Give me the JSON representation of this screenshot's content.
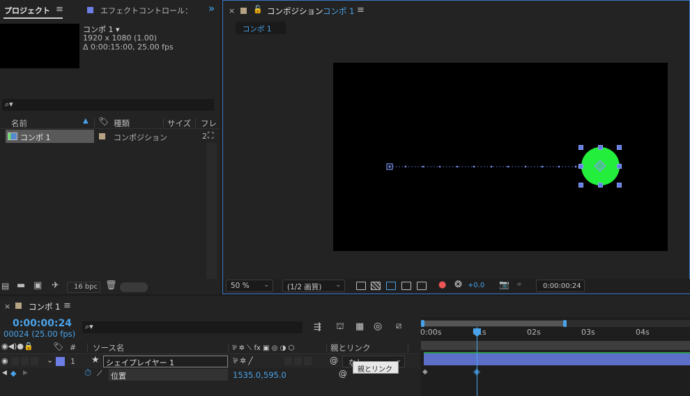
{
  "project_panel": {
    "tab_project": "プロジェクト",
    "tab_menu": "≡",
    "tab_effect": "エフェクトコントロール：",
    "more": "»",
    "comp_name": "コンポ 1 ▾",
    "comp_res": "1920 x 1080 (1.00)",
    "comp_dur": "Δ 0:00:15:00, 25.00 fps",
    "search_icon_text": "⌕▾",
    "col_name": "名前",
    "col_type": "種類",
    "col_size": "サイズ",
    "col_frame": "フレ",
    "item_name": "コンポ 1",
    "item_type": "コンポジション",
    "item_num": "2",
    "bpc": "16 bpc"
  },
  "comp_panel": {
    "close": "×",
    "title": "コンポジション",
    "title_comp": "コンポ 1",
    "menu": "≡",
    "subtab": "コンポ 1",
    "zoom": "50 %",
    "quality": "(1/2 画質)",
    "exposure": "+0.0",
    "timecode": "0:00:00:24"
  },
  "timeline": {
    "close": "×",
    "tab": "コンポ 1",
    "menu": "≡",
    "timecode": "0:00:00:24",
    "frames": "00024 (25.00 fps)",
    "search_text": "⌕▾",
    "col_num": "#",
    "col_source": "ソース名",
    "col_switches": "⅌ ✲ ⟍ fx ▣ ◎ ◑ ⬡",
    "col_parent": "親とリンク",
    "layer_num": "1",
    "layer_name": "シェイプレイヤー 1",
    "parent_value": "なし",
    "tooltip": "親とリンク",
    "prop_name": "位置",
    "prop_value": "1535.0,595.0",
    "ruler": [
      "0:00s",
      "01s",
      "02s",
      "03s",
      "04s"
    ]
  },
  "colors": {
    "accent": "#4aa3ea",
    "label_blue": "#6d7ee6",
    "green_circle": "#22ee3b",
    "layer_bar": "#5b6fc9"
  }
}
